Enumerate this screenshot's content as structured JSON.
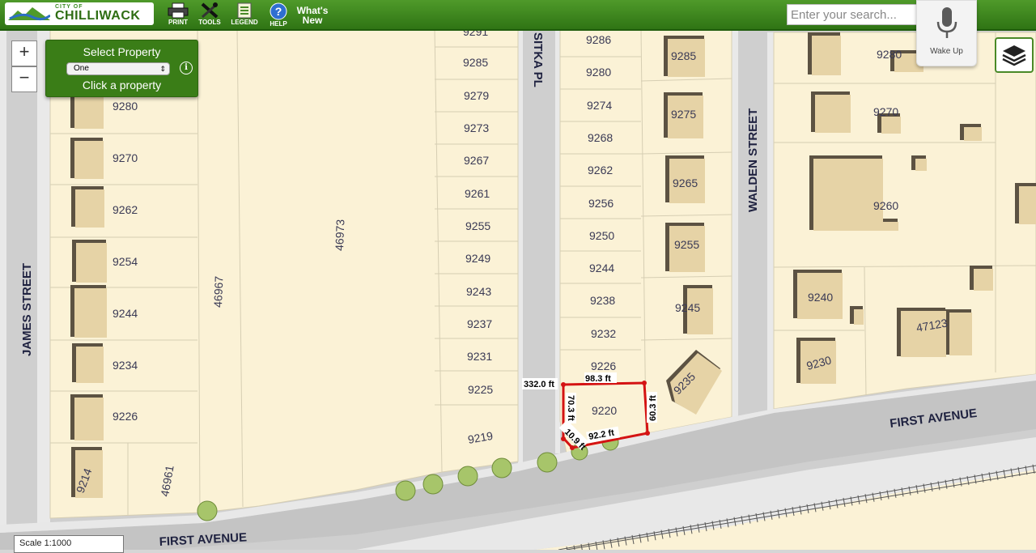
{
  "header": {
    "logo_small": "CITY OF",
    "logo_text": "CHILLIWACK",
    "tools": [
      {
        "label": "PRINT",
        "icon": "printer-icon"
      },
      {
        "label": "TOOLS",
        "icon": "tools-icon"
      },
      {
        "label": "LEGEND",
        "icon": "legend-icon"
      },
      {
        "label": "HELP",
        "icon": "help-icon"
      }
    ],
    "whats_new_line1": "What's",
    "whats_new_line2": "New",
    "search_placeholder": "Enter your search...",
    "wake_label": "Wake Up"
  },
  "zoom": {
    "in": "+",
    "out": "−"
  },
  "property_panel": {
    "title": "Select Property",
    "selected": "One",
    "subtitle": "Click a property"
  },
  "scale": "Scale 1:1000",
  "colors": {
    "toolbar": "#3a8520",
    "lot_fill": "#fbf2d6",
    "lot_border": "#d6ceb3",
    "road": "#c9c9c9",
    "building": "#e6d3a6",
    "building_shadow": "#5c5242",
    "tree": "#9dbd5e",
    "selection": "#d41313"
  },
  "map": {
    "streets": {
      "james": "JAMES STREET",
      "sitka": "SITKA PL",
      "walden": "WALDEN STREET",
      "first_avenue": "FIRST AVENUE"
    },
    "lot_labels": {
      "a9280": "9280",
      "a9270": "9270",
      "a9262": "9262",
      "a9254": "9254",
      "a9244": "9244",
      "a9234": "9234",
      "a9226": "9226",
      "a9214": "9214",
      "l46961": "46961",
      "l46967": "46967",
      "l46973": "46973",
      "b9291": "9291",
      "b9285": "9285",
      "b9279": "9279",
      "b9273": "9273",
      "b9267": "9267",
      "b9261": "9261",
      "b9255": "9255",
      "b9249": "9249",
      "b9243": "9243",
      "b9237": "9237",
      "b9231": "9231",
      "b9225": "9225",
      "b9219": "9219",
      "c9286": "9286",
      "c9280": "9280",
      "c9274": "9274",
      "c9268": "9268",
      "c9262": "9262",
      "c9256": "9256",
      "c9250": "9250",
      "c9244": "9244",
      "c9238": "9238",
      "c9232": "9232",
      "c9226": "9226",
      "c9220": "9220",
      "d9285": "9285",
      "d9275": "9275",
      "d9265": "9265",
      "d9255": "9255",
      "d9245": "9245",
      "d9235": "9235",
      "e9280": "9280",
      "e9270": "9270",
      "e9260": "9260",
      "e9240": "9240",
      "e9230": "9230",
      "e47123": "47123"
    },
    "measurements": {
      "m1": "332.0 ft",
      "m2": "98.3 ft",
      "m3": "70.3 ft",
      "m4": "60.3 ft",
      "m5": "92.2 ft",
      "m6": "10.9 ft"
    }
  }
}
